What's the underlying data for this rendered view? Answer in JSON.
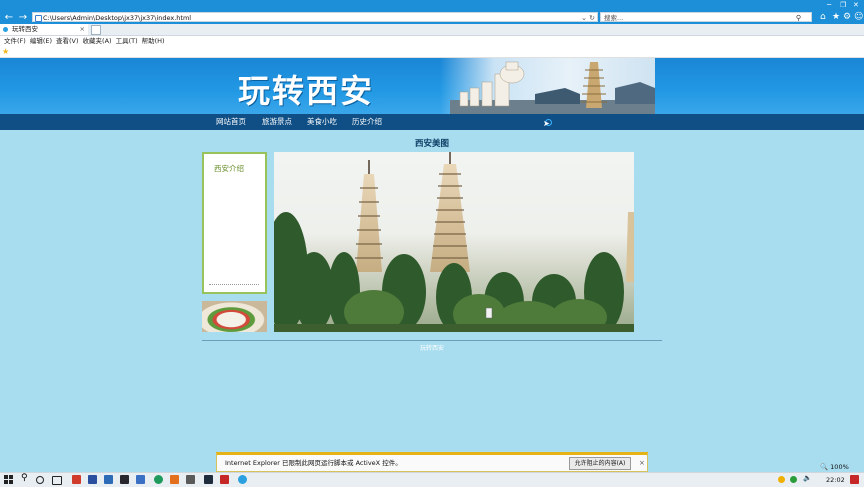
{
  "browser": {
    "address": "C:\\Users\\Admin\\Desktop\\jx37\\jx37\\index.html",
    "search_placeholder": "搜索...",
    "tab_title": "玩转西安",
    "menu": [
      "文件(F)",
      "编辑(E)",
      "查看(V)",
      "收藏夹(A)",
      "工具(T)",
      "帮助(H)"
    ],
    "zoom": "100%",
    "notification": {
      "text": "Internet Explorer 已限制此网页运行脚本或 ActiveX 控件。",
      "button": "允许阻止的内容(A)",
      "close": "×"
    }
  },
  "site": {
    "logo": "玩转西安",
    "nav": [
      "网站首页",
      "旅游景点",
      "美食小吃",
      "历史介绍"
    ],
    "section_title": "西安美图",
    "sidebar_title": "西安介绍",
    "footer": "玩转西安"
  },
  "taskbar": {
    "time": "22:02"
  }
}
